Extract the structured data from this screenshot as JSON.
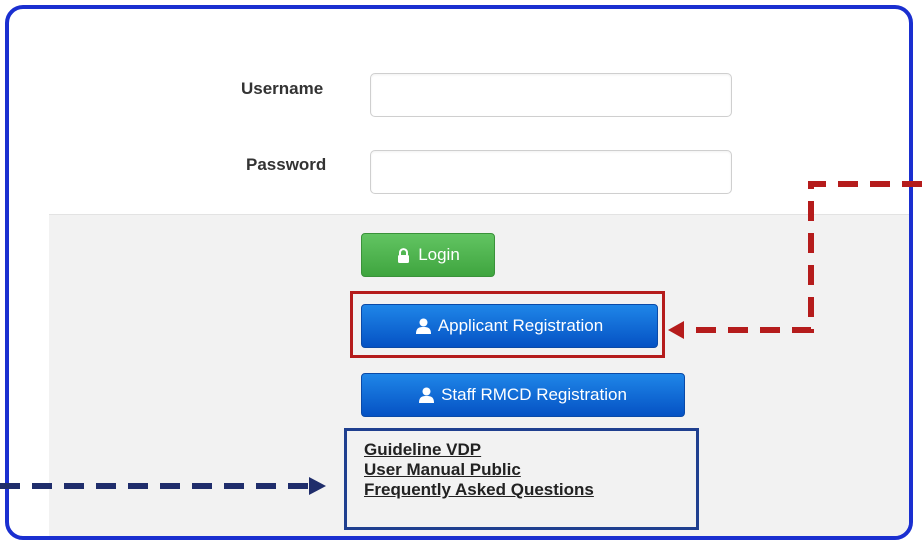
{
  "login_form": {
    "username_label": "Username",
    "username_value": "",
    "password_label": "Password",
    "password_value": ""
  },
  "actions": {
    "login_label": "Login",
    "login_icon": "lock-icon",
    "applicant_registration_label": "Applicant Registration",
    "applicant_registration_icon": "user-icon",
    "staff_registration_label": "Staff RMCD Registration",
    "staff_registration_icon": "user-icon"
  },
  "links": [
    "Guideline VDP",
    "User Manual Public",
    "Frequently Asked Questions"
  ],
  "colors": {
    "frame_border": "#1a2fd0",
    "login_button": "#4cb34c",
    "registration_button": "#0b63d6",
    "highlight_red": "#b51c1c",
    "highlight_navy": "#1f3f8f"
  }
}
